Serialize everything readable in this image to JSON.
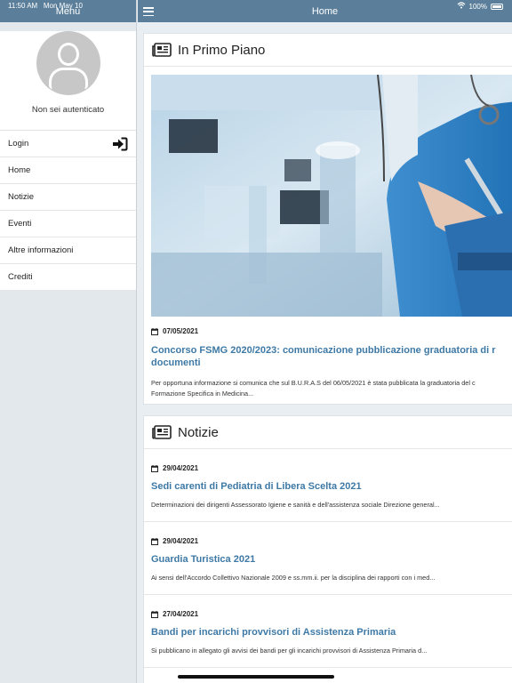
{
  "status": {
    "time": "11:50 AM",
    "date": "Mon May 10",
    "battery": "100%"
  },
  "sidebar": {
    "title": "Menu",
    "auth_text": "Non sei autenticato",
    "items": [
      {
        "label": "Login"
      },
      {
        "label": "Home"
      },
      {
        "label": "Notizie"
      },
      {
        "label": "Eventi"
      },
      {
        "label": "Altre informazioni"
      },
      {
        "label": "Crediti"
      }
    ]
  },
  "header": {
    "title": "Home"
  },
  "featured": {
    "heading": "In Primo Piano",
    "date": "07/05/2021",
    "title_line1": "Concorso FSMG 2020/2023: comunicazione pubblicazione graduatoria di r",
    "title_line2": "documenti",
    "text_line1": "Per opportuna informazione si comunica che sul B.U.R.A.S del 06/05/2021 è stata pubblicata la graduatoria del c",
    "text_line2": "Formazione Specifica in Medicina..."
  },
  "news": {
    "heading": "Notizie",
    "items": [
      {
        "date": "29/04/2021",
        "title": "Sedi carenti di Pediatria di Libera Scelta 2021",
        "text": "Determinazioni dei dirigenti Assessorato Igiene e sanità e dell'assistenza sociale Direzione general..."
      },
      {
        "date": "29/04/2021",
        "title": "Guardia Turistica 2021",
        "text": "Ai sensi dell'Accordo Collettivo Nazionale 2009 e ss.mm.ii. per la disciplina dei rapporti con i med..."
      },
      {
        "date": "27/04/2021",
        "title": "Bandi per incarichi provvisori di Assistenza Primaria",
        "text": "Si pubblicano in allegato gli avvisi dei bandi per gli incarichi provvisori di Assistenza Primaria d..."
      }
    ]
  },
  "colors": {
    "bar": "#5b7f9a",
    "link": "#3e79a6"
  }
}
